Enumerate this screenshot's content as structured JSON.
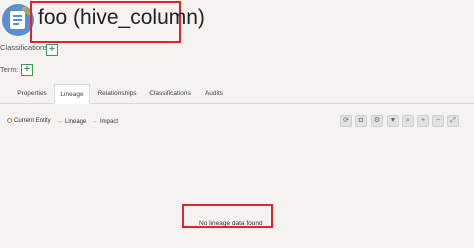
{
  "header": {
    "title": "foo (hive_column)",
    "icon": "entity-column-icon"
  },
  "classifications": {
    "label": "Classifications:",
    "add_label": "+"
  },
  "term": {
    "label": "Term:",
    "add_label": "+"
  },
  "tabs": [
    {
      "label": "Properties",
      "active": false
    },
    {
      "label": "Lineage",
      "active": true
    },
    {
      "label": "Relationships",
      "active": false
    },
    {
      "label": "Classifications",
      "active": false
    },
    {
      "label": "Audits",
      "active": false
    }
  ],
  "legend": {
    "current_entity": "Current Entity",
    "lineage": "Lineage",
    "impact": "Impact"
  },
  "toolbar": [
    "refresh",
    "camera",
    "settings",
    "filter",
    "search",
    "zoom-in",
    "zoom-out",
    "fullscreen"
  ],
  "lineage_message": "No lineage data found",
  "colors": {
    "accent": "#e8762a",
    "highlight_border": "#e0262b",
    "add_button": "#3a9c4d"
  }
}
